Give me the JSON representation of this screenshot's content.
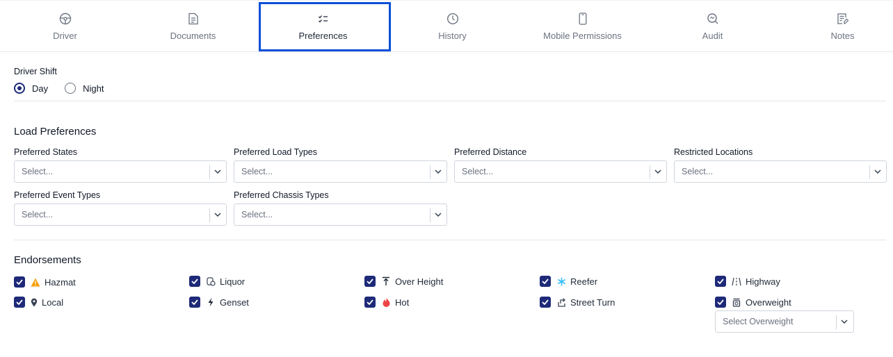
{
  "tabs": [
    {
      "label": "Driver",
      "icon": "steering-wheel-icon"
    },
    {
      "label": "Documents",
      "icon": "document-icon"
    },
    {
      "label": "Preferences",
      "icon": "checklist-icon"
    },
    {
      "label": "History",
      "icon": "history-icon"
    },
    {
      "label": "Mobile Permissions",
      "icon": "mobile-icon"
    },
    {
      "label": "Audit",
      "icon": "audit-icon"
    },
    {
      "label": "Notes",
      "icon": "notes-icon"
    }
  ],
  "active_tab": "Preferences",
  "driver_shift": {
    "label": "Driver Shift",
    "options": [
      {
        "label": "Day",
        "checked": true
      },
      {
        "label": "Night",
        "checked": false
      }
    ]
  },
  "load_preferences": {
    "title": "Load Preferences",
    "fields": [
      {
        "label": "Preferred States",
        "placeholder": "Select..."
      },
      {
        "label": "Preferred Load Types",
        "placeholder": "Select..."
      },
      {
        "label": "Preferred Distance",
        "placeholder": "Select..."
      },
      {
        "label": "Restricted Locations",
        "placeholder": "Select..."
      },
      {
        "label": "Preferred Event Types",
        "placeholder": "Select..."
      },
      {
        "label": "Preferred Chassis Types",
        "placeholder": "Select..."
      }
    ]
  },
  "endorsements": {
    "title": "Endorsements",
    "items": [
      {
        "label": "Hazmat",
        "icon": "warning-icon",
        "checked": true
      },
      {
        "label": "Liquor",
        "icon": "liquor-icon",
        "checked": true
      },
      {
        "label": "Over Height",
        "icon": "over-height-icon",
        "checked": true
      },
      {
        "label": "Reefer",
        "icon": "snowflake-icon",
        "checked": true
      },
      {
        "label": "Highway",
        "icon": "highway-icon",
        "checked": true
      },
      {
        "label": "Local",
        "icon": "location-pin-icon",
        "checked": true
      },
      {
        "label": "Genset",
        "icon": "lightning-icon",
        "checked": true
      },
      {
        "label": "Hot",
        "icon": "flame-icon",
        "checked": true
      },
      {
        "label": "Street Turn",
        "icon": "street-turn-icon",
        "checked": true
      },
      {
        "label": "Overweight",
        "icon": "weight-icon",
        "checked": true
      }
    ],
    "overweight_select": {
      "placeholder": "Select Overweight"
    }
  },
  "colors": {
    "accent": "#1e2a78",
    "tab_highlight": "#0b4fd8",
    "hazmat": "#f59e0b",
    "reefer": "#38bdf8",
    "hot": "#ef4444"
  }
}
